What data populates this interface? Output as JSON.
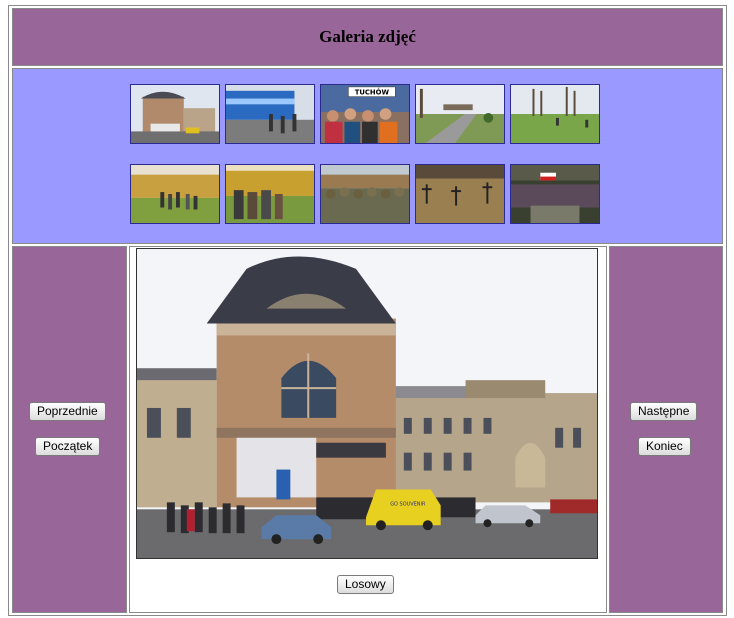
{
  "header": {
    "title": "Galeria zdjęć"
  },
  "thumbnails": [
    {
      "name": "thumb-station-building",
      "subject": "station-building"
    },
    {
      "name": "thumb-train-platform",
      "subject": "train-platform"
    },
    {
      "name": "thumb-tuchow-sign-group",
      "subject": "tuchow-sign-group",
      "sign": "TUCHÓW"
    },
    {
      "name": "thumb-road-walkers",
      "subject": "road-walkers"
    },
    {
      "name": "thumb-field-trees",
      "subject": "field-trees"
    },
    {
      "name": "thumb-field-hikers",
      "subject": "field-hikers"
    },
    {
      "name": "thumb-hikers-closeup",
      "subject": "hikers-closeup"
    },
    {
      "name": "thumb-crowd-hill",
      "subject": "crowd-hill"
    },
    {
      "name": "thumb-cemetery-crosses",
      "subject": "cemetery-crosses"
    },
    {
      "name": "thumb-flag-procession",
      "subject": "flag-procession"
    }
  ],
  "nav": {
    "previous_label": "Poprzednie",
    "start_label": "Początek",
    "next_label": "Następne",
    "end_label": "Koniec",
    "random_label": "Losowy"
  },
  "main_photo": {
    "subject": "railway-station-building",
    "van_text": "GO SOUVENIR"
  },
  "colors": {
    "header_bg": "#996699",
    "thumb_area_bg": "#9999ff",
    "side_bg": "#996699"
  }
}
